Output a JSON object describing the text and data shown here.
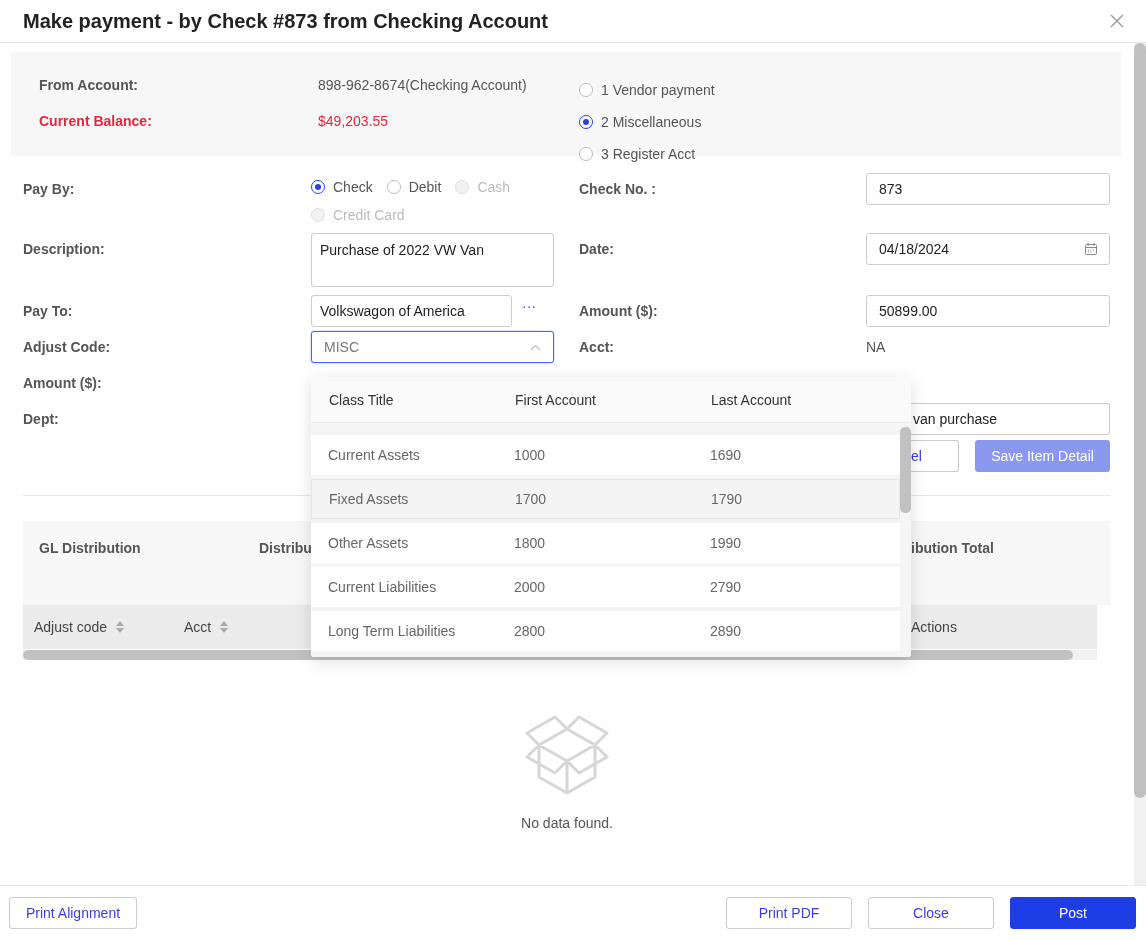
{
  "dialog": {
    "title": "Make payment - by Check #873 from Checking Account"
  },
  "account": {
    "from_label": "From Account:",
    "from_value": "898-962-8674(Checking Account)",
    "balance_label": "Current Balance:",
    "balance_value": "$49,203.55"
  },
  "payment_types": [
    {
      "label": "1 Vendor payment",
      "selected": false
    },
    {
      "label": "2 Miscellaneous",
      "selected": true
    },
    {
      "label": "3 Register Acct",
      "selected": false
    }
  ],
  "pay_by": {
    "label": "Pay By:",
    "options": [
      {
        "label": "Check",
        "selected": true,
        "disabled": false
      },
      {
        "label": "Debit",
        "selected": false,
        "disabled": false
      },
      {
        "label": "Cash",
        "selected": false,
        "disabled": true
      },
      {
        "label": "Credit Card",
        "selected": false,
        "disabled": true
      }
    ]
  },
  "check_no": {
    "label": "Check No. :",
    "value": "873"
  },
  "description": {
    "label": "Description:",
    "value": "Purchase of 2022 VW Van"
  },
  "date": {
    "label": "Date:",
    "value": "04/18/2024"
  },
  "pay_to": {
    "label": "Pay To:",
    "value": "Volkswagon of America",
    "more": "···"
  },
  "amount": {
    "label": "Amount ($):",
    "value": "50899.00"
  },
  "adjust_code": {
    "label": "Adjust Code:",
    "value": "MISC",
    "expanded": true
  },
  "acct": {
    "label": "Acct:",
    "value": "NA"
  },
  "item_amount": {
    "label": "Amount ($):"
  },
  "dept": {
    "label": "Dept:"
  },
  "memo": {
    "value": "van purchase"
  },
  "item_buttons": [
    {
      "label": "el"
    },
    {
      "label": "Save Item Detail",
      "disabled": true
    }
  ],
  "gl_panel": {
    "headings": [
      "GL Distribution",
      "Distribu",
      "ibution Total"
    ]
  },
  "table": {
    "columns": [
      {
        "label": "Adjust code",
        "sortable": true
      },
      {
        "label": "Acct",
        "sortable": true
      },
      {
        "label": "Actions",
        "sortable": false
      }
    ],
    "empty_text": "No data found."
  },
  "dropdown": {
    "columns": [
      "Class Title",
      "First Account",
      "Last Account"
    ],
    "rows": [
      {
        "cells": [
          "Current Assets",
          "1000",
          "1690"
        ],
        "selected": false
      },
      {
        "cells": [
          "Fixed Assets",
          "1700",
          "1790"
        ],
        "selected": true
      },
      {
        "cells": [
          "Other Assets",
          "1800",
          "1990"
        ],
        "selected": false
      },
      {
        "cells": [
          "Current Liabilities",
          "2000",
          "2790"
        ],
        "selected": false
      },
      {
        "cells": [
          "Long Term Liabilities",
          "2800",
          "2890"
        ],
        "selected": false
      }
    ]
  },
  "footer": {
    "left": [
      {
        "label": "Print Alignment",
        "primary": false
      }
    ],
    "right": [
      {
        "label": "Print PDF",
        "primary": false
      },
      {
        "label": "Close",
        "primary": false
      },
      {
        "label": "Post",
        "primary": true
      }
    ]
  }
}
